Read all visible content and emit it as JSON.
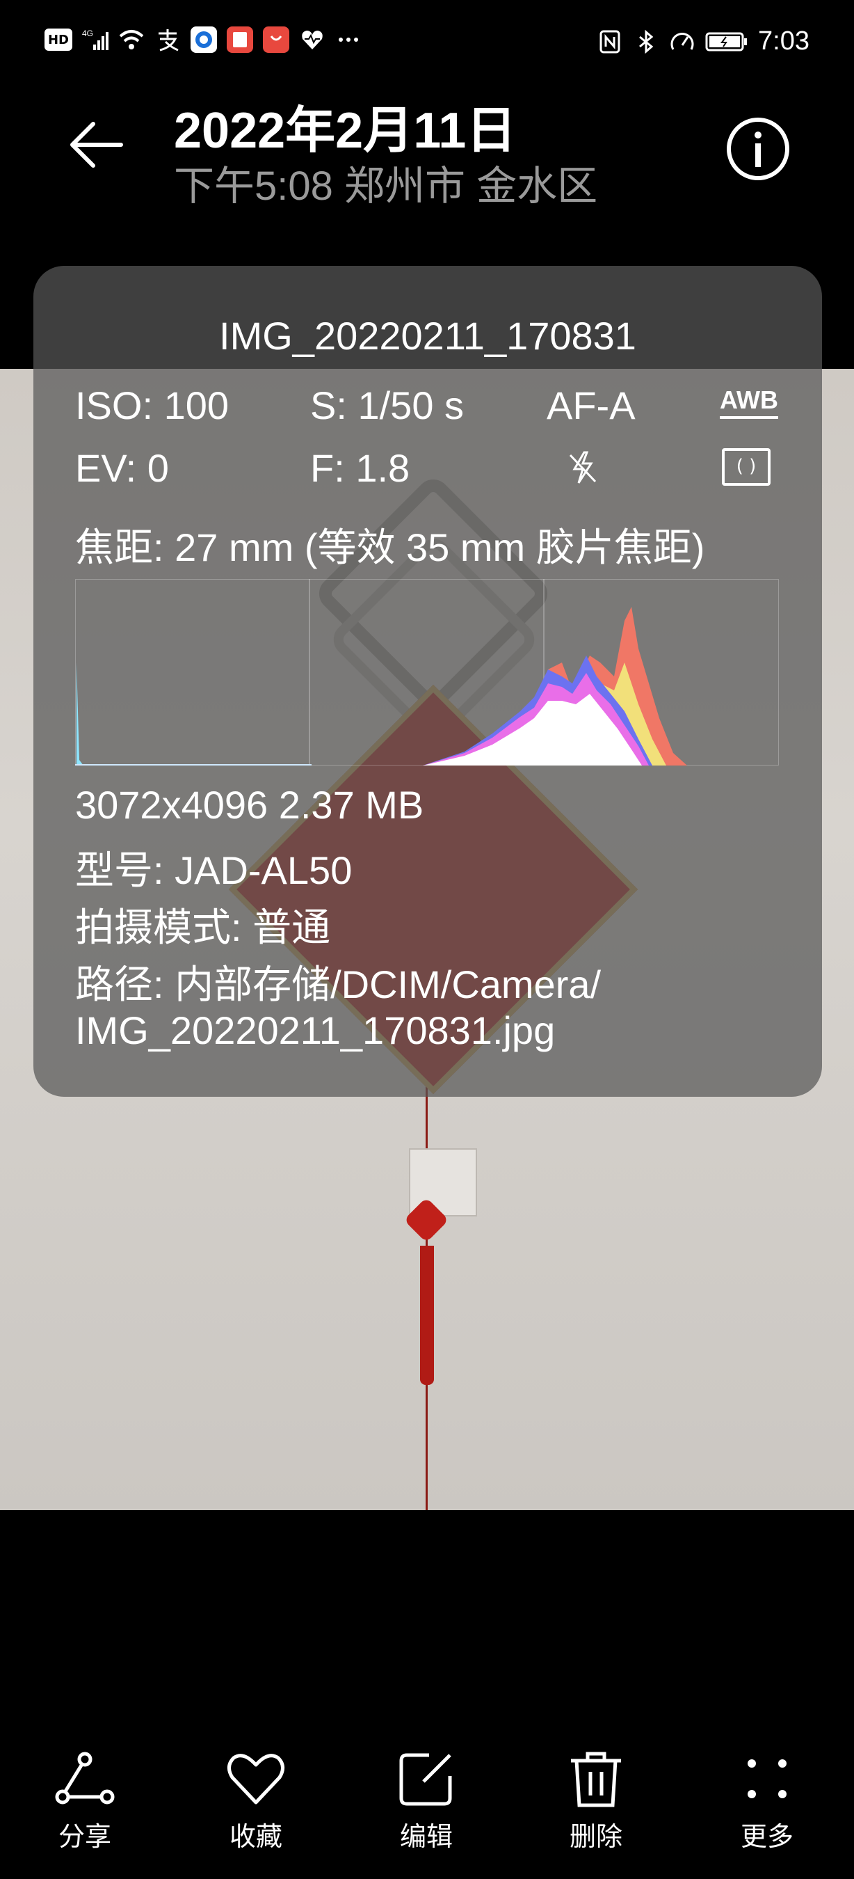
{
  "status_bar": {
    "time": "7:03",
    "left_icons": [
      "hd-icon",
      "signal-4g-icon",
      "wifi-icon",
      "alipay-icon",
      "browser-app-icon",
      "book-app-icon",
      "huawei-store-icon",
      "health-icon",
      "more-notifications-icon"
    ],
    "right_icons": [
      "nfc-icon",
      "bluetooth-icon",
      "speed-icon",
      "battery-icon"
    ]
  },
  "header": {
    "title": "2022年2月11日",
    "subtitle": "下午5:08 郑州市 金水区"
  },
  "details": {
    "filename": "IMG_20220211_170831",
    "iso": "ISO: 100",
    "shutter": "S: 1/50 s",
    "af": "AF-A",
    "awb": "AWB",
    "ev": "EV: 0",
    "aperture": "F: 1.8",
    "focal": "焦距: 27 mm (等效 35 mm 胶片焦距)",
    "resolution_size": "3072x4096 2.37 MB",
    "model": "型号:  JAD-AL50",
    "mode": "拍摄模式:  普通",
    "path_line1": "路径:  内部存储/DCIM/Camera/",
    "path_line2": "IMG_20220211_170831.jpg"
  },
  "toolbar": {
    "share": "分享",
    "favorite": "收藏",
    "edit": "编辑",
    "delete": "删除",
    "more": "更多"
  }
}
